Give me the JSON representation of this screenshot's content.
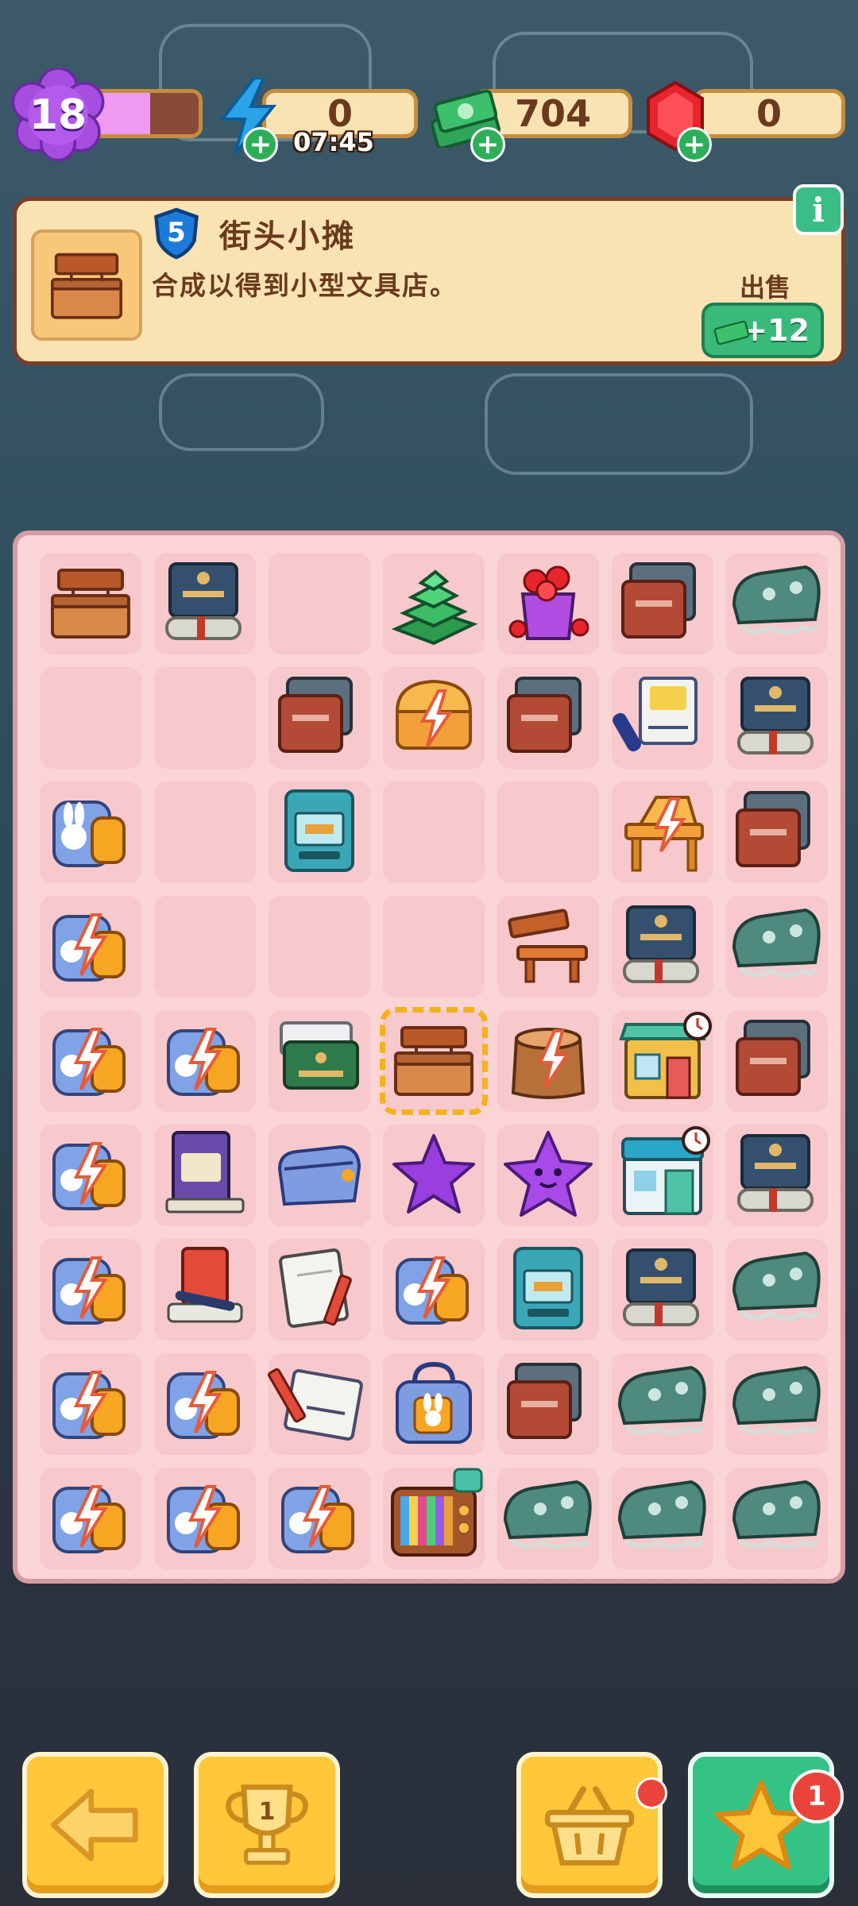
{
  "top_bar": {
    "player_level": "18",
    "level_progress": 0.55,
    "energy": "0",
    "energy_timer": "07:45",
    "cash": "704",
    "gems": "0"
  },
  "info_panel": {
    "item_level": "5",
    "item_title": "街头小摊",
    "item_description": "合成以得到小型文具店。",
    "sell_label": "出售",
    "sell_value": "+12",
    "info_button": "i"
  },
  "board": {
    "selected_cell": 31,
    "cells": [
      "vendor-stall",
      "degree-book",
      "empty",
      "cash-pile",
      "gem-bag",
      "folders",
      "green-pencil-case",
      "empty",
      "empty",
      "folders",
      "energy-chest",
      "folders",
      "homework-book",
      "degree-book",
      "bunny-backpack",
      "empty",
      "atm",
      "empty",
      "empty",
      "energy-table",
      "folders",
      "energy-backpack",
      "empty",
      "empty",
      "empty",
      "wood-bench",
      "degree-book",
      "green-pencil-case",
      "energy-backpack",
      "energy-backpack",
      "degree-paper",
      "vendor-stall",
      "energy-stump",
      "shop-building",
      "folders",
      "energy-backpack",
      "book-stack",
      "blue-pouch",
      "purple-star",
      "purple-star-face",
      "store-24h",
      "degree-book",
      "energy-backpack",
      "desk-supplies",
      "notebook-pencil",
      "energy-backpack",
      "atm",
      "degree-book",
      "green-pencil-case",
      "energy-backpack",
      "energy-backpack",
      "math-paper",
      "bunny-bag",
      "folders",
      "green-pencil-case",
      "green-pencil-case",
      "energy-backpack",
      "energy-backpack",
      "energy-backpack",
      "tv-set",
      "green-pencil-case",
      "green-pencil-case",
      "green-pencil-case"
    ]
  },
  "bottom_nav": {
    "back_icon": "arrow-left-icon",
    "trophy_count": "1",
    "basket_icon": "basket-icon",
    "star_badge": "1"
  },
  "colors": {
    "board_bg": "#fbd4d6",
    "panel_bg": "#f9e3b3",
    "accent_green": "#39b97a",
    "accent_yellow": "#ffc73a"
  }
}
